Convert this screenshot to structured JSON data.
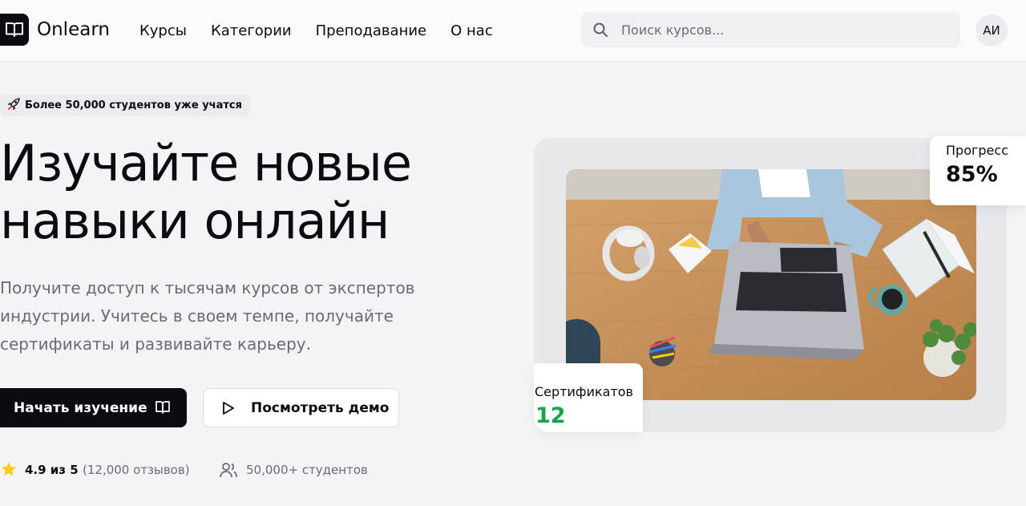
{
  "header": {
    "brand": "Onlearn",
    "nav": [
      "Курсы",
      "Категории",
      "Преподавание",
      "О нас"
    ],
    "search_placeholder": "Поиск курсов...",
    "avatar_initials": "АИ"
  },
  "hero": {
    "badge_icon": "rocket-icon",
    "badge_text": "Более 50,000 студентов уже учатся",
    "title_line1": "Изучайте новые",
    "title_line2": "навыки онлайн",
    "subtitle_line1": "Получите доступ к тысячам курсов от экспертов",
    "subtitle_line2": "индустрии. Учитесь в своем темпе, получайте",
    "subtitle_line3": "сертификаты и развивайте карьеру.",
    "primary_button": "Начать изучение",
    "secondary_button": "Посмотреть демо",
    "rating": "4.9 из 5",
    "reviews": "(12,000 отзывов)",
    "students": "50,000+ студентов"
  },
  "cards": {
    "progress_label": "Прогресс",
    "progress_value": "85%",
    "certificates_label": "Сертификатов",
    "certificates_value": "12"
  },
  "colors": {
    "primary": "#0b0b12",
    "accent_green": "#16a34a",
    "star": "#facc15"
  }
}
